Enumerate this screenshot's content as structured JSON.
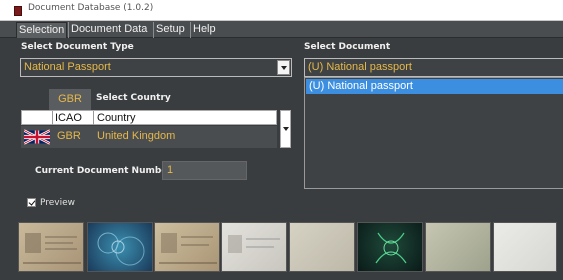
{
  "window": {
    "title": "Document Database (1.0.2)"
  },
  "menu": {
    "tabs": [
      "Selection",
      "Document Data",
      "Setup",
      "Help"
    ]
  },
  "doc_type": {
    "label": "Select Document Type",
    "value": "National Passport"
  },
  "select_document": {
    "label": "Select Document",
    "value": "(U) National passport",
    "list_items": [
      "(U) National passport"
    ]
  },
  "country": {
    "tab": "GBR",
    "label": "Select Country",
    "headers": [
      "ICAO",
      "Country"
    ],
    "rows": [
      {
        "code": "GBR",
        "name": "United Kingdom"
      }
    ]
  },
  "doc_number": {
    "label": "Current Document Number",
    "value": "1"
  },
  "preview": {
    "label": "Preview",
    "checked": true
  },
  "thumbnails": [
    {
      "style": "passport-beige"
    },
    {
      "style": "passport-blue-pattern"
    },
    {
      "style": "passport-beige-2"
    },
    {
      "style": "passport-light"
    },
    {
      "style": "passport-plain"
    },
    {
      "style": "passport-uv-dark"
    },
    {
      "style": "passport-grey-green"
    },
    {
      "style": "passport-white"
    }
  ],
  "colors": {
    "accent_text": "#e6b84a",
    "selection": "#3c8fe0",
    "background": "#3a3d3f"
  }
}
